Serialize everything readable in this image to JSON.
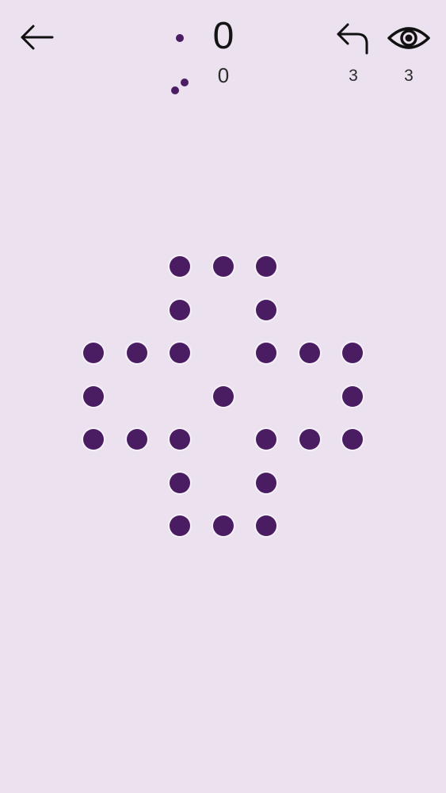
{
  "header": {
    "back_icon": "arrow-left-icon",
    "score": {
      "main_value": "0",
      "sub_value": "0",
      "single_icon": "single-dot-icon",
      "pair_icon": "pair-dots-icon"
    },
    "undo": {
      "icon": "undo-arrow-icon",
      "count": "3"
    },
    "hint": {
      "icon": "eye-icon",
      "count": "3"
    }
  },
  "board": {
    "peg_color": "#4a1d62",
    "background_color": "#ebe1ef",
    "grid_rows": 7,
    "grid_cols": 7,
    "pegs": [
      {
        "row": 0,
        "col": 2
      },
      {
        "row": 0,
        "col": 3
      },
      {
        "row": 0,
        "col": 4
      },
      {
        "row": 1,
        "col": 2
      },
      {
        "row": 1,
        "col": 4
      },
      {
        "row": 2,
        "col": 0
      },
      {
        "row": 2,
        "col": 1
      },
      {
        "row": 2,
        "col": 2
      },
      {
        "row": 2,
        "col": 4
      },
      {
        "row": 2,
        "col": 5
      },
      {
        "row": 2,
        "col": 6
      },
      {
        "row": 3,
        "col": 0
      },
      {
        "row": 3,
        "col": 3
      },
      {
        "row": 3,
        "col": 6
      },
      {
        "row": 4,
        "col": 0
      },
      {
        "row": 4,
        "col": 1
      },
      {
        "row": 4,
        "col": 2
      },
      {
        "row": 4,
        "col": 4
      },
      {
        "row": 4,
        "col": 5
      },
      {
        "row": 4,
        "col": 6
      },
      {
        "row": 5,
        "col": 2
      },
      {
        "row": 5,
        "col": 4
      },
      {
        "row": 6,
        "col": 2
      },
      {
        "row": 6,
        "col": 3
      },
      {
        "row": 6,
        "col": 4
      }
    ]
  }
}
